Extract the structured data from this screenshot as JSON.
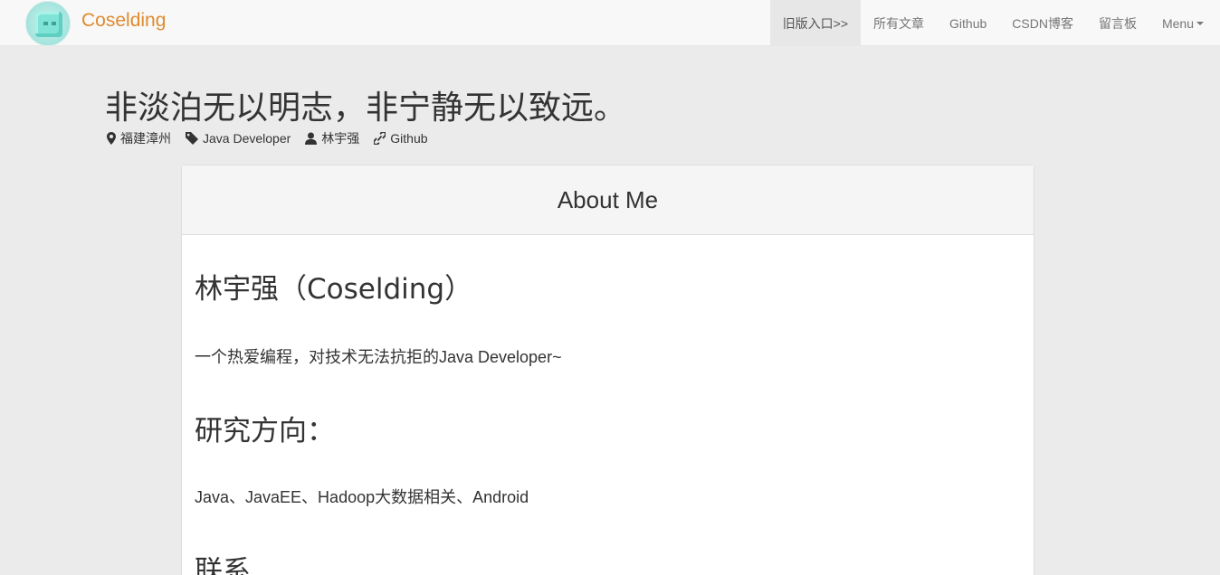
{
  "navbar": {
    "brand": "Coselding",
    "items": [
      {
        "label": "旧版入口>>"
      },
      {
        "label": "所有文章"
      },
      {
        "label": "Github"
      },
      {
        "label": "CSDN博客"
      },
      {
        "label": "留言板"
      },
      {
        "label": "Menu"
      }
    ]
  },
  "header": {
    "title": "非淡泊无以明志，非宁静无以致远。",
    "meta": {
      "location": "福建漳州",
      "tag": "Java Developer",
      "user": "林宇强",
      "link": "Github"
    }
  },
  "panel": {
    "heading": "About Me",
    "name_heading": "林宇强（Coselding）",
    "intro": "一个热爱编程，对技术无法抗拒的Java Developer~",
    "research_heading": "研究方向：",
    "research": "Java、JavaEE、Hadoop大数据相关、Android",
    "contact_heading": "联系"
  },
  "icons": {
    "location": "map-marker-icon",
    "tag": "tag-icon",
    "user": "user-icon",
    "link": "link-icon"
  },
  "colors": {
    "brand": "#e08a2e",
    "background": "#ebebeb",
    "navbar": "#f8f8f8"
  }
}
